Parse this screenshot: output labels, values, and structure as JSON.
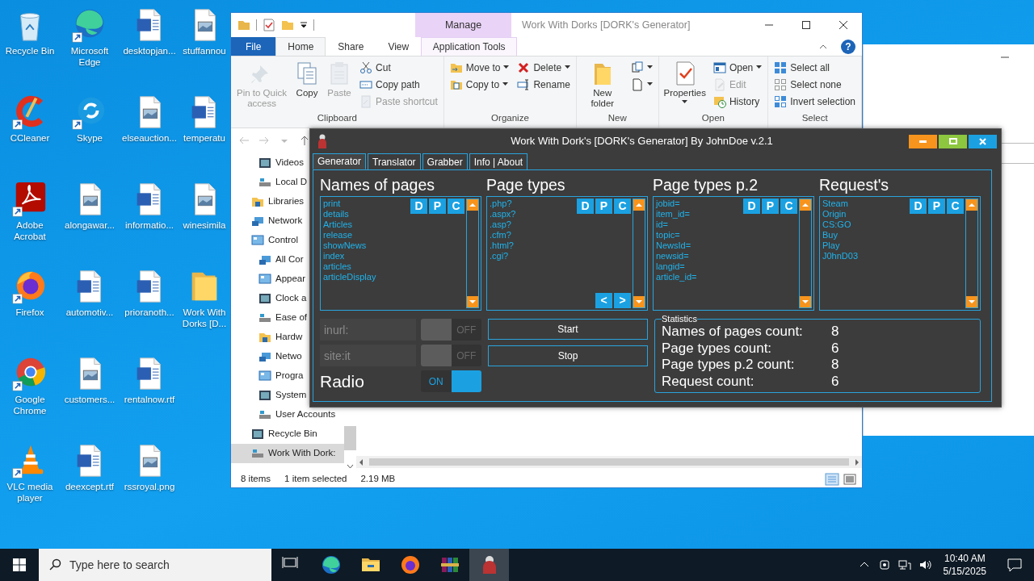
{
  "desktop": {
    "icons": [
      {
        "label": "Recycle Bin",
        "kind": "bin",
        "shortcut": false
      },
      {
        "label": "CCleaner",
        "kind": "ccleaner",
        "shortcut": true
      },
      {
        "label": "Adobe Acrobat",
        "kind": "acrobat",
        "shortcut": true
      },
      {
        "label": "Firefox",
        "kind": "firefox",
        "shortcut": true
      },
      {
        "label": "Google Chrome",
        "kind": "chrome",
        "shortcut": true
      },
      {
        "label": "VLC media player",
        "kind": "vlc",
        "shortcut": true
      },
      {
        "label": "Microsoft Edge",
        "kind": "edge",
        "shortcut": true
      },
      {
        "label": "Skype",
        "kind": "skype",
        "shortcut": true
      },
      {
        "label": "alongawar...",
        "kind": "image",
        "shortcut": false
      },
      {
        "label": "automotiv...",
        "kind": "word",
        "shortcut": false
      },
      {
        "label": "customers...",
        "kind": "image",
        "shortcut": false
      },
      {
        "label": "deexcept.rtf",
        "kind": "word",
        "shortcut": false
      },
      {
        "label": "desktopjan...",
        "kind": "word",
        "shortcut": false
      },
      {
        "label": "elseauction...",
        "kind": "image",
        "shortcut": false
      },
      {
        "label": "informatio...",
        "kind": "word",
        "shortcut": false
      },
      {
        "label": "prioranoth...",
        "kind": "word",
        "shortcut": false
      },
      {
        "label": "rentalnow.rtf",
        "kind": "word",
        "shortcut": false
      },
      {
        "label": "rssroyal.png",
        "kind": "image",
        "shortcut": false
      },
      {
        "label": "stuffannou",
        "kind": "image",
        "shortcut": false
      },
      {
        "label": "temperatu",
        "kind": "word",
        "shortcut": false
      },
      {
        "label": "winesimila",
        "kind": "image",
        "shortcut": false
      },
      {
        "label": "Work With Dorks [D...",
        "kind": "folder",
        "shortcut": false
      }
    ]
  },
  "explorer": {
    "title": "Work With Dorks [DORK's Generator]",
    "context_tab": "Manage",
    "help": "?",
    "tabs": [
      {
        "label": "File",
        "kind": "file",
        "selected": false
      },
      {
        "label": "Home",
        "kind": "plain",
        "selected": true
      },
      {
        "label": "Share",
        "kind": "plain",
        "selected": false
      },
      {
        "label": "View",
        "kind": "plain",
        "selected": false
      },
      {
        "label": "Application Tools",
        "kind": "context",
        "selected": false
      }
    ],
    "ribbon": [
      {
        "name": "Clipboard",
        "columns": [
          [
            {
              "label": "Pin to Quick access",
              "kind": "large",
              "disabled": true,
              "dropdown": false
            }
          ],
          [
            {
              "label": "Copy",
              "kind": "large",
              "disabled": false,
              "dropdown": false
            }
          ],
          [
            {
              "label": "Paste",
              "kind": "large",
              "disabled": true,
              "dropdown": false
            }
          ],
          [
            {
              "label": "Cut",
              "kind": "small",
              "disabled": false,
              "dropdown": false
            },
            {
              "label": "Copy path",
              "kind": "small",
              "disabled": false,
              "dropdown": false
            },
            {
              "label": "Paste shortcut",
              "kind": "small",
              "disabled": true,
              "dropdown": false
            }
          ]
        ]
      },
      {
        "name": "Organize",
        "columns": [
          [
            {
              "label": "Move to",
              "kind": "small",
              "disabled": false,
              "dropdown": true
            },
            {
              "label": "Copy to",
              "kind": "small",
              "disabled": false,
              "dropdown": true
            }
          ],
          [
            {
              "label": "Delete",
              "kind": "small",
              "disabled": false,
              "dropdown": true
            },
            {
              "label": "Rename",
              "kind": "small",
              "disabled": false,
              "dropdown": false
            }
          ]
        ]
      },
      {
        "name": "New",
        "columns": [
          [
            {
              "label": "New folder",
              "kind": "large",
              "disabled": false,
              "dropdown": false
            }
          ],
          [
            {
              "kind": "icon",
              "disabled": false,
              "dropdown": true
            },
            {
              "kind": "icon",
              "disabled": false,
              "dropdown": true
            }
          ]
        ]
      },
      {
        "name": "Open",
        "columns": [
          [
            {
              "label": "Properties",
              "kind": "large",
              "disabled": false,
              "dropdown": true
            }
          ],
          [
            {
              "label": "Open",
              "kind": "small",
              "disabled": false,
              "dropdown": true
            },
            {
              "label": "Edit",
              "kind": "small",
              "disabled": true,
              "dropdown": false
            },
            {
              "label": "History",
              "kind": "small",
              "disabled": false,
              "dropdown": false
            }
          ]
        ]
      },
      {
        "name": "Select",
        "columns": [
          [
            {
              "label": "Select all",
              "kind": "small",
              "disabled": false,
              "dropdown": false
            },
            {
              "label": "Select none",
              "kind": "small",
              "disabled": false,
              "dropdown": false
            },
            {
              "label": "Invert selection",
              "kind": "small",
              "disabled": false,
              "dropdown": false
            }
          ]
        ]
      }
    ],
    "sidebar": {
      "scrolled_children": [
        {
          "label": "Videos",
          "selected": false
        },
        {
          "label": "Local D",
          "selected": false
        }
      ],
      "items": [
        {
          "label": "Libraries",
          "selected": false
        },
        {
          "label": "Network",
          "selected": false
        },
        {
          "label": "Control",
          "selected": false,
          "children": [
            {
              "label": "All Cor",
              "selected": false
            },
            {
              "label": "Appear",
              "selected": false
            },
            {
              "label": "Clock a",
              "selected": false
            },
            {
              "label": "Ease of",
              "selected": false
            },
            {
              "label": "Hardw",
              "selected": false
            },
            {
              "label": "Netwo",
              "selected": false
            },
            {
              "label": "Progra",
              "selected": false
            },
            {
              "label": "System",
              "selected": false
            },
            {
              "label": "User Accounts",
              "selected": false
            }
          ]
        },
        {
          "label": "Recycle Bin",
          "selected": false
        },
        {
          "label": "Work With Dork:",
          "selected": true
        }
      ]
    },
    "status_bar": [
      "8 items",
      "1 item selected",
      "2.19 MB"
    ]
  },
  "dork": {
    "title": "Work With Dork's [DORK's Generator] By JohnDoe v.2.1",
    "tabs": [
      {
        "label": "Generator",
        "selected": true
      },
      {
        "label": "Translator",
        "selected": false
      },
      {
        "label": "Grabber",
        "selected": false
      },
      {
        "label": "Info | About",
        "selected": false
      }
    ],
    "lists": [
      {
        "heading": "Names of pages",
        "items": [
          "print",
          "details",
          "Articles",
          "release",
          "showNews",
          "index",
          "articles",
          "articleDisplay"
        ],
        "actions": [
          "D",
          "P",
          "C"
        ]
      },
      {
        "heading": "Page types",
        "items": [
          ".php?",
          ".aspx?",
          ".asp?",
          ".cfm?",
          ".html?",
          ".cgi?"
        ],
        "actions": [
          "D",
          "P",
          "C"
        ],
        "pager": [
          "<",
          ">"
        ]
      },
      {
        "heading": "Page types p.2",
        "items": [
          "jobid=",
          "item_id=",
          "id=",
          "topic=",
          "NewsId=",
          "newsid=",
          "langid=",
          "article_id="
        ],
        "actions": [
          "D",
          "P",
          "C"
        ]
      },
      {
        "heading": "Request's",
        "items": [
          "Steam",
          "Origin",
          "CS:GO",
          "Buy",
          "Play",
          "J0hnD03"
        ],
        "actions": [
          "D",
          "P",
          "C"
        ]
      }
    ],
    "options": [
      {
        "kind": "field",
        "text": "inurl:",
        "on": false,
        "switch_text": "OFF"
      },
      {
        "kind": "field",
        "text": "site:it",
        "on": false,
        "switch_text": "OFF"
      },
      {
        "kind": "label",
        "text": "Radio",
        "on": true,
        "switch_text": "ON"
      }
    ],
    "buttons": [
      "Start",
      "Stop"
    ],
    "statistics": {
      "title": "Statistics",
      "rows": [
        {
          "label": "Names of pages count:",
          "value": "8"
        },
        {
          "label": "Page types count:",
          "value": "6"
        },
        {
          "label": "Page types p.2 count:",
          "value": "8"
        },
        {
          "label": "Request count:",
          "value": "6"
        }
      ]
    }
  },
  "taskbar": {
    "search_placeholder": "Type here to search",
    "apps": [
      {
        "kind": "taskview",
        "active": false
      },
      {
        "kind": "edge",
        "active": false
      },
      {
        "kind": "explorer",
        "active": false
      },
      {
        "kind": "firefox",
        "active": false
      },
      {
        "kind": "winrar",
        "active": false
      },
      {
        "kind": "dork",
        "active": true
      }
    ],
    "time": "10:40 AM",
    "date": "5/15/2025"
  }
}
